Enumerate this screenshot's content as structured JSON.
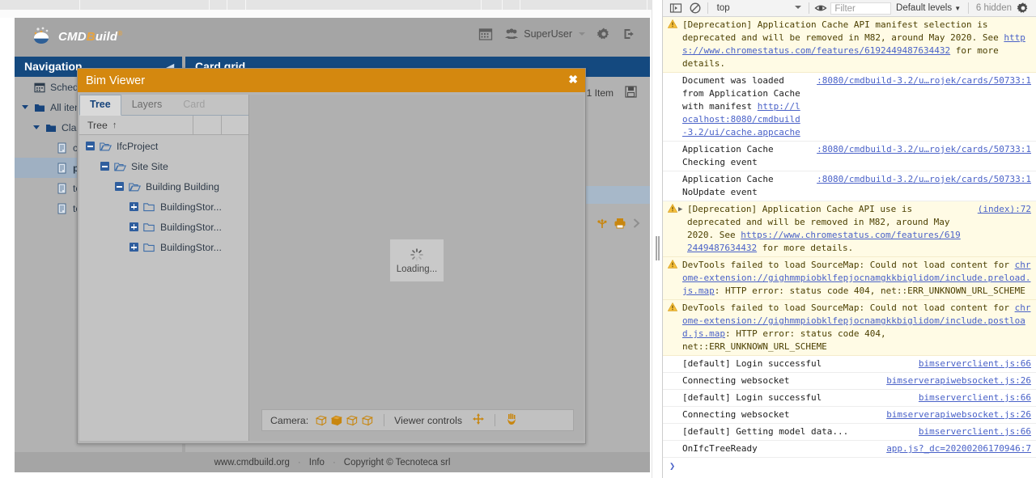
{
  "browser": {
    "strip_segments": [
      168,
      443,
      482,
      521,
      1022,
      1066,
      1104,
      1375
    ]
  },
  "app": {
    "logo_text_left": "CMD",
    "logo_text_mid": "B",
    "logo_text_right": "uild",
    "logo_trademark": "®",
    "header": {
      "calendar_icon": "calendar-icon",
      "users_icon": "users-group-icon",
      "user_name": "SuperUser",
      "gear_icon": "gear-icon",
      "logout_icon": "logout-icon"
    },
    "navigation": {
      "title": "Navigation",
      "collapse_icon": "collapse-left-icon",
      "items": [
        {
          "label": "Schedul",
          "icon": "calendar-icon",
          "indent": 0,
          "twisty": "none",
          "selected": false
        },
        {
          "label": "All items",
          "icon": "folder-icon",
          "indent": 0,
          "twisty": "down",
          "selected": false
        },
        {
          "label": "Class",
          "icon": "folder-icon",
          "indent": 1,
          "twisty": "down",
          "selected": false
        },
        {
          "label": "col",
          "icon": "document-icon",
          "indent": 2,
          "twisty": "none",
          "selected": false
        },
        {
          "label": "pr",
          "icon": "document-icon",
          "indent": 2,
          "twisty": "none",
          "selected": true
        },
        {
          "label": "tes",
          "icon": "document-icon",
          "indent": 2,
          "twisty": "none",
          "selected": false
        },
        {
          "label": "tes",
          "icon": "document-icon",
          "indent": 2,
          "twisty": "none",
          "selected": false
        }
      ]
    },
    "card_panel": {
      "title": "Card grid",
      "item_count": "1 Item",
      "save_icon": "floppy-save-icon",
      "usb_icon": "usb-attachment-icon",
      "print_icon": "printer-icon",
      "next_icon": "chevron-right-icon"
    },
    "footer": {
      "site": "www.cmdbuild.org",
      "dot1": "·",
      "info": "Info",
      "dot2": "·",
      "copyright": "Copyright © Tecnoteca srl"
    }
  },
  "modal": {
    "title": "Bim Viewer",
    "close_label": "✖",
    "tabs": [
      {
        "label": "Tree",
        "state": "active"
      },
      {
        "label": "Layers",
        "state": "normal"
      },
      {
        "label": "Card",
        "state": "disabled"
      }
    ],
    "tree_column_header": "Tree",
    "tree_sort_icon": "↑",
    "tree_rows": [
      {
        "label": "IfcProject",
        "indent": 0,
        "expander": "minus",
        "folder": "open"
      },
      {
        "label": "Site Site",
        "indent": 1,
        "expander": "minus",
        "folder": "open"
      },
      {
        "label": "Building Building",
        "indent": 2,
        "expander": "minus",
        "folder": "open"
      },
      {
        "label": "BuildingStor...",
        "indent": 3,
        "expander": "plus",
        "folder": "closed"
      },
      {
        "label": "BuildingStor...",
        "indent": 3,
        "expander": "plus",
        "folder": "closed"
      },
      {
        "label": "BuildingStor...",
        "indent": 3,
        "expander": "plus",
        "folder": "closed"
      }
    ],
    "loading": {
      "text": "Loading...",
      "spinner_icon": "spinner-icon"
    },
    "toolbar": {
      "camera_label": "Camera:",
      "camera_buttons": [
        {
          "name": "camera-view-1",
          "active": false
        },
        {
          "name": "camera-view-2",
          "active": true
        },
        {
          "name": "camera-view-3",
          "active": false
        },
        {
          "name": "camera-view-4",
          "active": false
        }
      ],
      "viewer_controls_label": "Viewer controls",
      "pan_icon": "move-arrows-icon",
      "hand_icon": "hand-grab-icon"
    }
  },
  "devtools": {
    "toolbar": {
      "sidebar_icon": "show-console-sidebar-icon",
      "clear_icon": "clear-console-icon",
      "context": "top",
      "eye_icon": "live-expression-eye-icon",
      "filter_placeholder": "Filter",
      "filter_value": "",
      "levels": "Default levels",
      "levels_caret": "▼",
      "hidden_count": "6 hidden",
      "settings_icon": "settings-gear-icon"
    },
    "messages": [
      {
        "level": "warn",
        "expandable": false,
        "parts": [
          {
            "t": "text",
            "v": "[Deprecation] Application Cache API manifest selection is deprecated and will be removed in M82, around May 2020. See "
          },
          {
            "t": "link",
            "v": "https://www.chromestatus.com/features/6192449487634432"
          },
          {
            "t": "text",
            "v": " for more details."
          }
        ],
        "source": ""
      },
      {
        "level": "info",
        "expandable": false,
        "parts": [
          {
            "t": "text",
            "v": "Document was loaded from Application Cache with manifest "
          },
          {
            "t": "link",
            "v": "http://localhost:8080/cmdbuild-3.2/ui/cache.appcache"
          }
        ],
        "source": ":8080/cmdbuild-3.2/u…rojek/cards/50733:1"
      },
      {
        "level": "info",
        "expandable": false,
        "parts": [
          {
            "t": "text",
            "v": "Application Cache Checking event"
          }
        ],
        "source": ":8080/cmdbuild-3.2/u…rojek/cards/50733:1"
      },
      {
        "level": "info",
        "expandable": false,
        "parts": [
          {
            "t": "text",
            "v": "Application Cache NoUpdate event"
          }
        ],
        "source": ":8080/cmdbuild-3.2/u…rojek/cards/50733:1"
      },
      {
        "level": "warn",
        "expandable": true,
        "parts": [
          {
            "t": "text",
            "v": "[Deprecation] Application Cache API use is deprecated and will be removed in M82, around May 2020. See "
          },
          {
            "t": "link",
            "v": "https://www.chromestatus.com/features/6192449487634432"
          },
          {
            "t": "text",
            "v": " for more details."
          }
        ],
        "source": "(index):72"
      },
      {
        "level": "warn",
        "expandable": false,
        "parts": [
          {
            "t": "text",
            "v": "DevTools failed to load SourceMap: Could not load content for "
          },
          {
            "t": "link",
            "v": "chrome-extension://gighmmpiobklfepjocnamgkkbiglidom/include.preload.js.map"
          },
          {
            "t": "text",
            "v": ": HTTP error: status code 404, net::ERR_UNKNOWN_URL_SCHEME"
          }
        ],
        "source": ""
      },
      {
        "level": "warn",
        "expandable": false,
        "parts": [
          {
            "t": "text",
            "v": "DevTools failed to load SourceMap: Could not load content for "
          },
          {
            "t": "link",
            "v": "chrome-extension://gighmmpiobklfepjocnamgkkbiglidom/include.postload.js.map"
          },
          {
            "t": "text",
            "v": ": HTTP error: status code 404, net::ERR_UNKNOWN_URL_SCHEME"
          }
        ],
        "source": ""
      },
      {
        "level": "info",
        "expandable": false,
        "parts": [
          {
            "t": "text",
            "v": "[default] Login successful"
          }
        ],
        "source": "bimserverclient.js:66"
      },
      {
        "level": "info",
        "expandable": false,
        "parts": [
          {
            "t": "text",
            "v": "Connecting websocket"
          }
        ],
        "source": "bimserverapiwebsocket.js:26"
      },
      {
        "level": "info",
        "expandable": false,
        "parts": [
          {
            "t": "text",
            "v": "[default] Login successful"
          }
        ],
        "source": "bimserverclient.js:66"
      },
      {
        "level": "info",
        "expandable": false,
        "parts": [
          {
            "t": "text",
            "v": "Connecting websocket"
          }
        ],
        "source": "bimserverapiwebsocket.js:26"
      },
      {
        "level": "info",
        "expandable": false,
        "parts": [
          {
            "t": "text",
            "v": "[default] Getting model data..."
          }
        ],
        "source": "bimserverclient.js:66"
      },
      {
        "level": "info",
        "expandable": false,
        "parts": [
          {
            "t": "text",
            "v": "OnIfcTreeReady"
          }
        ],
        "source": "app.js?_dc=20200206170946:7"
      }
    ],
    "prompt": "❯"
  },
  "colors": {
    "accent_orange": "#d4880f",
    "header_blue": "#14497f",
    "app_gray": "#a5a5a5",
    "panel_gray": "#b2b2b2",
    "warn_bg": "#fffbe5",
    "link_blue": "#4a62c8"
  }
}
